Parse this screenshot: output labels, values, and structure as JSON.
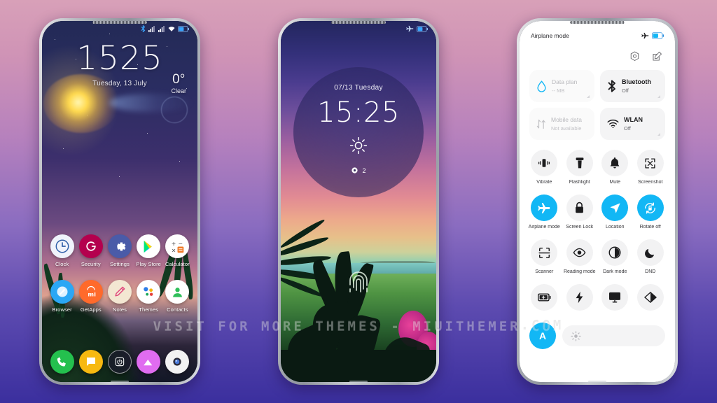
{
  "watermark": "VISIT FOR MORE THEMES - MIUITHEMER.COM",
  "phone1": {
    "name": "home-screen",
    "statusbar": {
      "icons": [
        "bluetooth-icon",
        "signal-icon",
        "signal-icon",
        "wifi-icon",
        "battery-icon"
      ]
    },
    "clock": {
      "time": "1525",
      "date": "Tuesday, 13 July"
    },
    "weather": {
      "temp": "0°",
      "condition": "Clear"
    },
    "apps": [
      [
        {
          "label": "Clock",
          "icon": "clock-icon"
        },
        {
          "label": "Security",
          "icon": "security-icon"
        },
        {
          "label": "Settings",
          "icon": "gear-icon"
        },
        {
          "label": "Play Store",
          "icon": "play-store-icon"
        },
        {
          "label": "Calculator",
          "icon": "calculator-icon"
        }
      ],
      [
        {
          "label": "Browser",
          "icon": "browser-icon"
        },
        {
          "label": "GetApps",
          "icon": "getapps-icon"
        },
        {
          "label": "Notes",
          "icon": "notes-icon"
        },
        {
          "label": "Themes",
          "icon": "themes-icon"
        },
        {
          "label": "Contacts",
          "icon": "contacts-icon"
        }
      ]
    ],
    "dock": [
      {
        "label": "Phone",
        "icon": "phone-icon"
      },
      {
        "label": "Messages",
        "icon": "messages-icon"
      },
      {
        "label": "Power",
        "icon": "power-icon"
      },
      {
        "label": "Gallery",
        "icon": "gallery-icon"
      },
      {
        "label": "Camera",
        "icon": "camera-icon"
      }
    ]
  },
  "phone2": {
    "name": "lock-screen",
    "statusbar": {
      "icons": [
        "airplane-icon",
        "battery-icon"
      ]
    },
    "lock": {
      "date": "07/13 Tuesday",
      "time": "15:25",
      "weather_icon": "sun-icon",
      "notification_icon": "notification-icon",
      "notification_count": "2"
    },
    "fingerprint_icon": "fingerprint-icon"
  },
  "phone3": {
    "name": "control-center",
    "title": "Airplane mode",
    "statusbar": {
      "icons": [
        "airplane-icon",
        "battery-icon"
      ]
    },
    "actions": [
      {
        "name": "settings-gear-icon",
        "label": "Settings"
      },
      {
        "name": "edit-icon",
        "label": "Edit"
      }
    ],
    "cards": [
      {
        "title": "Data plan",
        "sub": "-- MB",
        "icon": "water-drop-icon",
        "muted": true,
        "corner": true
      },
      {
        "title": "Bluetooth",
        "sub": "Off",
        "icon": "bluetooth-icon",
        "muted": false,
        "corner": true
      },
      {
        "title": "Mobile data",
        "sub": "Not available",
        "icon": "mobile-data-icon",
        "muted": true,
        "corner": false
      },
      {
        "title": "WLAN",
        "sub": "Off",
        "icon": "wifi-icon",
        "muted": false,
        "corner": true
      }
    ],
    "toggles": [
      [
        {
          "label": "Vibrate",
          "icon": "vibrate-icon",
          "on": false
        },
        {
          "label": "Flashlight",
          "icon": "flashlight-icon",
          "on": false
        },
        {
          "label": "Mute",
          "icon": "bell-icon",
          "on": false
        },
        {
          "label": "Screenshot",
          "icon": "screenshot-icon",
          "on": false
        }
      ],
      [
        {
          "label": "Airplane mode",
          "icon": "airplane-icon",
          "on": true
        },
        {
          "label": "Screen Lock",
          "icon": "lock-icon",
          "on": false
        },
        {
          "label": "Location",
          "icon": "location-icon",
          "on": true
        },
        {
          "label": "Rotate off",
          "icon": "rotate-lock-icon",
          "on": true
        }
      ],
      [
        {
          "label": "Scanner",
          "icon": "scanner-icon",
          "on": false
        },
        {
          "label": "Reading mode",
          "icon": "eye-icon",
          "on": false
        },
        {
          "label": "Dark mode",
          "icon": "dark-mode-icon",
          "on": false
        },
        {
          "label": "DND",
          "icon": "moon-icon",
          "on": false
        }
      ],
      [
        {
          "label": "",
          "icon": "battery-saver-icon",
          "on": false
        },
        {
          "label": "",
          "icon": "ultra-battery-icon",
          "on": false
        },
        {
          "label": "",
          "icon": "cast-icon",
          "on": false
        },
        {
          "label": "",
          "icon": "color-mode-icon",
          "on": false
        }
      ]
    ],
    "brightness": {
      "auto_label": "A",
      "slider_icon": "brightness-icon"
    }
  },
  "colors": {
    "accent_blue": "#12b7f5",
    "bg_top": "#d8a0b8",
    "bg_bottom": "#3b2f9e"
  }
}
